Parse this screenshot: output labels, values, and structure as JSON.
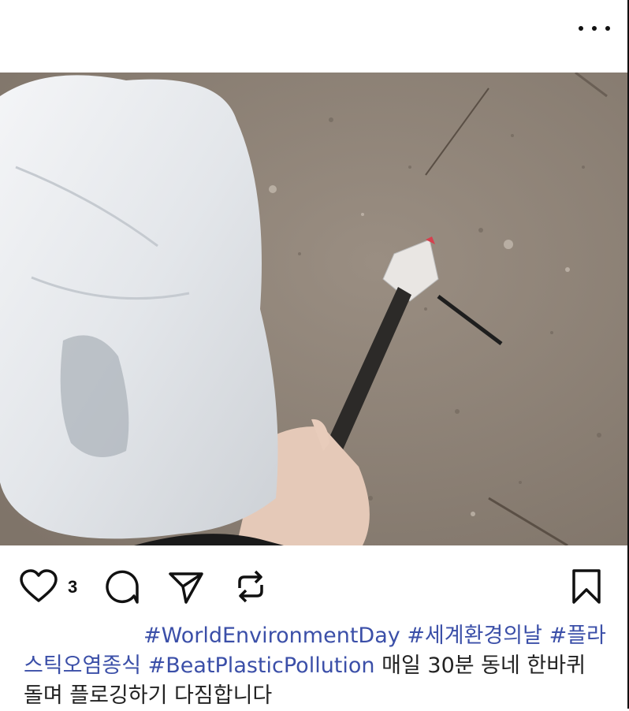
{
  "post": {
    "like_count": "3",
    "caption": {
      "hashtags_line1": [
        "#WorldEnvironmentDay",
        "#세계환경의날",
        "#플라"
      ],
      "hashtags_line2": [
        "스틱오염종식",
        "#BeatPlasticPollution"
      ],
      "text_line2": "매일 30분 동네 한바퀴",
      "text_line3": "돌며 플로깅하기 다짐합니다"
    }
  },
  "icons": {
    "more": "more-horizontal-icon",
    "like": "heart-icon",
    "comment": "comment-icon",
    "share": "send-icon",
    "repost": "repost-icon",
    "save": "bookmark-icon"
  },
  "colors": {
    "hashtag": "#3b4fa8",
    "text": "#222222",
    "ground": "#8f8276"
  }
}
